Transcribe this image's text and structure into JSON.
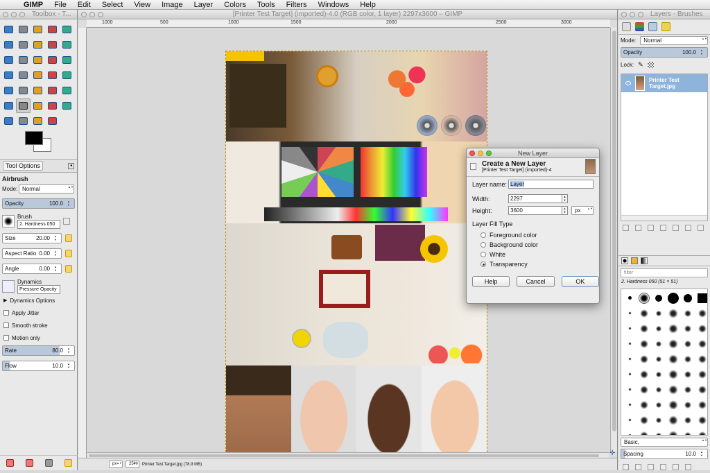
{
  "menubar": {
    "app": "GIMP",
    "items": [
      "File",
      "Edit",
      "Select",
      "View",
      "Image",
      "Layer",
      "Colors",
      "Tools",
      "Filters",
      "Windows",
      "Help"
    ]
  },
  "toolbox": {
    "title": "Toolbox - T...",
    "tool_icons": [
      "rect-select",
      "ellipse-select",
      "free-select",
      "fuzzy-select",
      "select-by-color",
      "scissors",
      "foreground-select",
      "paths",
      "color-picker",
      "zoom",
      "measure",
      "move",
      "align",
      "crop",
      "rotate",
      "scale",
      "shear",
      "perspective",
      "flip",
      "cage",
      "text",
      "bucket-fill",
      "blend",
      "pencil",
      "paintbrush",
      "eraser",
      "airbrush",
      "ink",
      "clone",
      "heal",
      "perspective-clone",
      "blur",
      "smudge",
      "dodge-burn"
    ],
    "selected_tool": "airbrush",
    "fg_color": "#000000",
    "bg_color": "#ffffff"
  },
  "tool_options": {
    "tab_label": "Tool Options",
    "tool_name": "Airbrush",
    "mode_label": "Mode:",
    "mode_value": "Normal",
    "opacity_label": "Opacity",
    "opacity_value": "100.0",
    "brush_label": "Brush",
    "brush_value": "2. Hardness 050",
    "size_label": "Size",
    "size_value": "20.00",
    "aspect_label": "Aspect Ratio",
    "aspect_value": "0.00",
    "angle_label": "Angle",
    "angle_value": "0.00",
    "dynamics_label": "Dynamics",
    "dynamics_value": "Pressure Opacity",
    "dynamics_options": "Dynamics Options",
    "apply_jitter": "Apply Jitter",
    "smooth_stroke": "Smooth stroke",
    "motion_only": "Motion only",
    "rate_label": "Rate",
    "rate_value": "80.0",
    "flow_label": "Flow",
    "flow_value": "10.0"
  },
  "image_window": {
    "title": "[Printer Test Target] (imported)-4.0 (RGB color, 1 layer) 2297x3600 – GIMP",
    "ruler_ticks": [
      "1000",
      "500",
      "1000",
      "1500",
      "2000",
      "2500",
      "3000"
    ],
    "status_unit": "px",
    "status_zoom": "25%",
    "status_text": "Printer Test Target.jpg (78.9 MB)"
  },
  "dialog": {
    "window_title": "New Layer",
    "heading": "Create a New Layer",
    "subheading": "[Printer Test Target] (imported)-4",
    "layer_name_label": "Layer name:",
    "layer_name_value": "Layer",
    "width_label": "Width:",
    "width_value": "2297",
    "height_label": "Height:",
    "height_value": "3600",
    "unit": "px",
    "fill_type_label": "Layer Fill Type",
    "fill_options": [
      "Foreground color",
      "Background color",
      "White",
      "Transparency"
    ],
    "selected_fill": "Transparency",
    "help_button": "Help",
    "cancel_button": "Cancel",
    "ok_button": "OK"
  },
  "layers_dock": {
    "title": "Layers - Brushes",
    "mode_label": "Mode:",
    "mode_value": "Normal",
    "opacity_label": "Opacity",
    "opacity_value": "100.0",
    "lock_label": "Lock:",
    "layer_name": "Printer Test Target.jpg"
  },
  "brushes_dock": {
    "filter_placeholder": "filter",
    "brush_name": "2. Hardness 050 (51 × 51)",
    "tag_value": "Basic,",
    "spacing_label": "Spacing",
    "spacing_value": "10.0"
  }
}
